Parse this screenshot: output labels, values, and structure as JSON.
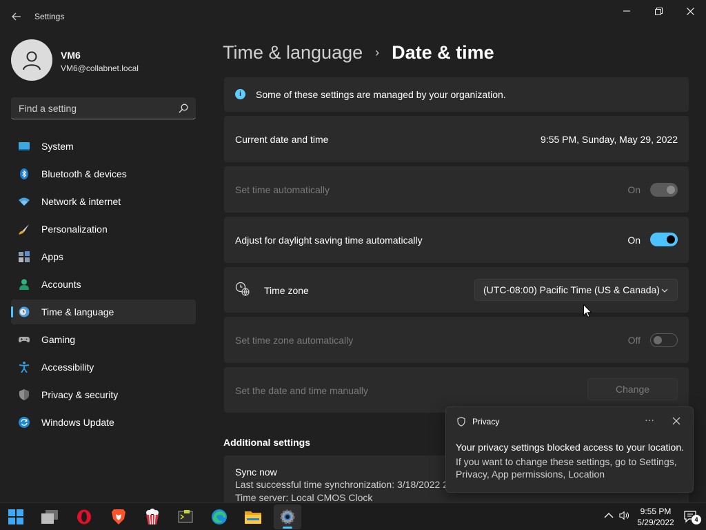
{
  "window": {
    "title": "Settings",
    "back_icon": "back-arrow-icon",
    "controls": [
      "minimize-icon",
      "maximize-icon",
      "close-icon"
    ]
  },
  "profile": {
    "name": "VM6",
    "email": "VM6@collabnet.local"
  },
  "search": {
    "placeholder": "Find a setting"
  },
  "sidebar": {
    "items": [
      {
        "label": "System",
        "icon": "system-icon"
      },
      {
        "label": "Bluetooth & devices",
        "icon": "bluetooth-icon"
      },
      {
        "label": "Network & internet",
        "icon": "wifi-icon"
      },
      {
        "label": "Personalization",
        "icon": "brush-icon"
      },
      {
        "label": "Apps",
        "icon": "apps-icon"
      },
      {
        "label": "Accounts",
        "icon": "accounts-icon"
      },
      {
        "label": "Time & language",
        "icon": "time-language-icon",
        "selected": true
      },
      {
        "label": "Gaming",
        "icon": "gaming-icon"
      },
      {
        "label": "Accessibility",
        "icon": "accessibility-icon"
      },
      {
        "label": "Privacy & security",
        "icon": "shield-icon"
      },
      {
        "label": "Windows Update",
        "icon": "windows-update-icon"
      }
    ]
  },
  "breadcrumb": {
    "parent": "Time & language",
    "separator": "›",
    "current": "Date & time"
  },
  "main": {
    "org_notice": "Some of these settings are managed by your organization.",
    "current_datetime_label": "Current date and time",
    "current_datetime_value": "9:55 PM, Sunday, May 29, 2022",
    "set_time_auto": {
      "label": "Set time automatically",
      "state": "On",
      "enabled": false
    },
    "daylight_saving": {
      "label": "Adjust for daylight saving time automatically",
      "state": "On",
      "enabled": true
    },
    "time_zone": {
      "label": "Time zone",
      "value": "(UTC-08:00) Pacific Time (US & Canada)"
    },
    "set_tz_auto": {
      "label": "Set time zone automatically",
      "state": "Off",
      "enabled": false
    },
    "manual": {
      "label": "Set the date and time manually",
      "button": "Change",
      "enabled": false
    },
    "additional_heading": "Additional settings",
    "sync": {
      "title": "Sync now",
      "last_sync": "Last successful time synchronization: 3/18/2022 2",
      "server": "Time server: Local CMOS Clock"
    }
  },
  "toast": {
    "title": "Privacy",
    "more": "···",
    "message": "Your privacy settings blocked access to your location.",
    "detail": "If you want to change these settings, go to Settings, Privacy, App permissions, Location"
  },
  "taskbar": {
    "apps": [
      "start-icon",
      "task-view-icon",
      "opera-icon",
      "brave-icon",
      "popcorn-icon",
      "terminal-icon",
      "edge-icon",
      "file-explorer-icon",
      "settings-icon"
    ],
    "time": "9:55 PM",
    "date": "5/29/2022",
    "notification_count": "4"
  },
  "colors": {
    "accent": "#4cc2ff",
    "background": "#202020",
    "card": "#2b2b2b",
    "info": "#60cdff"
  }
}
